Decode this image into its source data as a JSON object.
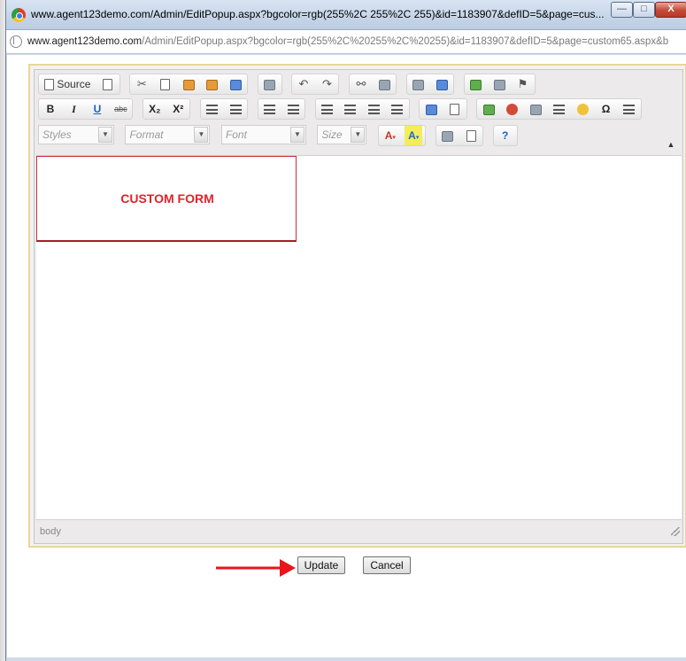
{
  "window": {
    "title": "www.agent123demo.com/Admin/EditPopup.aspx?bgcolor=rgb(255%2C 255%2C 255)&id=1183907&defID=5&page=cus...",
    "controls": {
      "minimize": "—",
      "maximize": "□",
      "close": "X"
    }
  },
  "address": {
    "host": "www.agent123demo.com",
    "path": "/Admin/EditPopup.aspx?bgcolor=rgb(255%2C%20255%2C%20255)&id=1183907&defID=5&page=custom65.aspx&b"
  },
  "toolbar": {
    "source_label": "Source",
    "bold": "B",
    "italic": "I",
    "underline": "U",
    "strike": "abc",
    "subscript": "X₂",
    "superscript": "X²",
    "special_char": "Ω",
    "help": "?",
    "font_color": "A",
    "bg_color": "A",
    "styles_label": "Styles",
    "format_label": "Format",
    "font_label": "Font",
    "size_label": "Size",
    "expand": "▲"
  },
  "editor": {
    "content_text": "CUSTOM FORM",
    "content_color": "#e0232b",
    "status_path": "body"
  },
  "actions": {
    "update_label": "Update",
    "cancel_label": "Cancel",
    "arrow_color": "#e8151b"
  }
}
